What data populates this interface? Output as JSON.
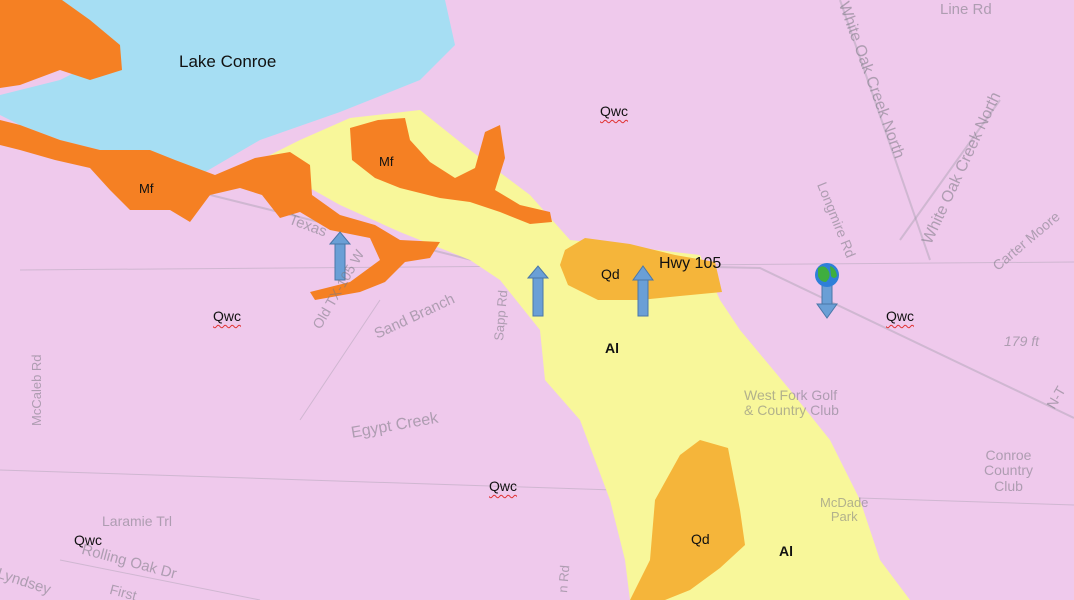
{
  "map": {
    "water_labels": {
      "lake": "Lake Conroe"
    },
    "highway_label": "Hwy 105",
    "geologic_units": {
      "qwc_1": "Qwc",
      "qwc_2": "Qwc",
      "qwc_3": "Qwc",
      "qwc_4": "Qwc",
      "qwc_5": "Qwc",
      "mf_1": "Mf",
      "mf_2": "Mf",
      "qd_1": "Qd",
      "qd_2": "Qd",
      "al_1": "Al",
      "al_2": "Al"
    },
    "road_labels": {
      "white_oak_creek_north_1": "White Oak Creek North",
      "white_oak_creek_north_2": "White Oak Creek North",
      "line_rd": "Line Rd",
      "longmire_rd": "Longmire Rd",
      "carter_moore": "Carter Moore",
      "texas_105": "Texas",
      "old_tx_105": "Old TX-105 W",
      "sand_branch": "Sand Branch",
      "sapp_rd": "Sapp Rd",
      "egypt_creek": "Egypt Creek",
      "mccaleb_rd": "McCaleb Rd",
      "laramie_trl": "Laramie Trl",
      "rolling_oak_dr": "Rolling Oak Dr",
      "lyndsey": "Lyndsey",
      "first": "First",
      "n_road": "N-T",
      "an_rd": "n Rd",
      "elevation": "179 ft",
      "golf_club": "West Fork Golf\n& Country Club",
      "conroe_club": "Conroe\nCountry\nClub",
      "mcdade_park": "McDade\nPark"
    },
    "colors": {
      "background": "#efc9ec",
      "water": "#a6def3",
      "alluvium": "#f8f79a",
      "qd": "#f5b53a",
      "mf": "#f58023",
      "arrow": "#6a9fd6"
    },
    "icons": [
      "globe-icon",
      "arrow-up-icon",
      "arrow-down-icon"
    ]
  }
}
